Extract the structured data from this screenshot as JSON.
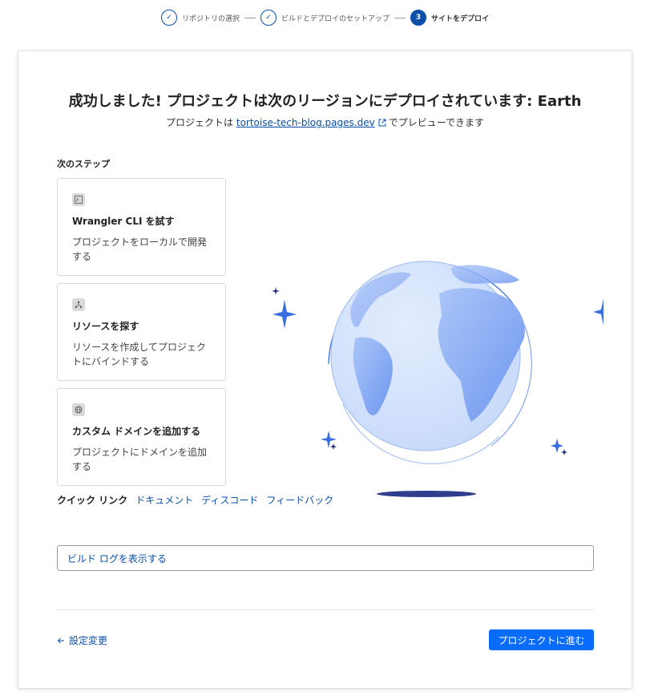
{
  "stepper": {
    "steps": [
      {
        "label": "リポジトリの選択",
        "marker": "✓",
        "state": "done"
      },
      {
        "label": "ビルドとデプロイのセットアップ",
        "marker": "✓",
        "state": "done"
      },
      {
        "label": "サイトをデプロイ",
        "marker": "3",
        "state": "active"
      }
    ]
  },
  "header": {
    "title": "成功しました! プロジェクトは次のリージョンにデプロイされています: Earth",
    "subtitle_prefix": "プロジェクトは",
    "subtitle_link": "tortoise-tech-blog.pages.dev",
    "subtitle_suffix": "でプレビューできます"
  },
  "next_steps": {
    "heading": "次のステップ",
    "cards": [
      {
        "title": "Wrangler CLI を試す",
        "desc": "プロジェクトをローカルで開発する",
        "icon": "terminal-icon"
      },
      {
        "title": "リソースを探す",
        "desc": "リソースを作成してプロジェクトにバインドする",
        "icon": "network-icon"
      },
      {
        "title": "カスタム ドメインを追加する",
        "desc": "プロジェクトにドメインを追加する",
        "icon": "globe-icon"
      }
    ]
  },
  "quick_links": {
    "label": "クイック リンク",
    "links": [
      "ドキュメント",
      "ディスコード",
      "フィードバック"
    ]
  },
  "build_log": {
    "label": "ビルド ログを表示する"
  },
  "footer": {
    "back_label": "設定変更",
    "primary_label": "プロジェクトに進む"
  },
  "colors": {
    "accent": "#0a6cff",
    "link": "#0b4fa8",
    "globe": "#8fb2f5"
  }
}
